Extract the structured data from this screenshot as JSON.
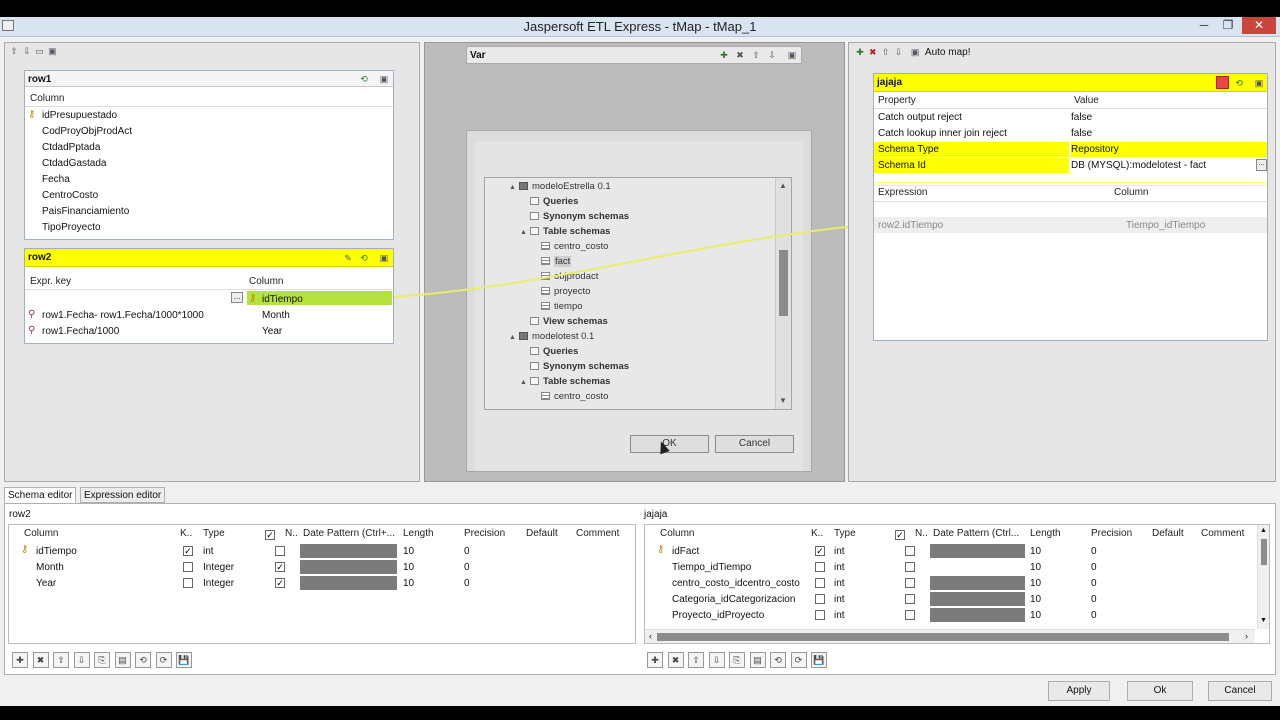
{
  "window": {
    "title": "Jaspersoft ETL Express - tMap - tMap_1",
    "minimize": "─",
    "maximize": "❐",
    "close": "✕"
  },
  "input": {
    "row1": {
      "title": "row1",
      "column_header": "Column",
      "columns": [
        "idPresupuestado",
        "CodProyObjProdAct",
        "CtdadPptada",
        "CtdadGastada",
        "Fecha",
        "CentroCosto",
        "PaisFinanciamiento",
        "TipoProyecto"
      ]
    },
    "row2": {
      "title": "row2",
      "expr_header": "Expr. key",
      "column_header": "Column",
      "ellipsis": "...",
      "rows": [
        {
          "expr": "",
          "column": "idTiempo"
        },
        {
          "expr": "row1.Fecha- row1.Fecha/1000*1000",
          "column": "Month"
        },
        {
          "expr": "row1.Fecha/1000",
          "column": "Year"
        }
      ]
    }
  },
  "var": {
    "title": "Var"
  },
  "dialog": {
    "tree": [
      {
        "label": "modeloEstrella 0.1",
        "level": 0,
        "kind": "db",
        "arrow": "▲"
      },
      {
        "label": "Queries",
        "level": 1,
        "kind": "folder",
        "bold": true
      },
      {
        "label": "Synonym schemas",
        "level": 1,
        "kind": "folder",
        "bold": true
      },
      {
        "label": "Table schemas",
        "level": 1,
        "kind": "folder",
        "bold": true,
        "arrow": "▲"
      },
      {
        "label": "centro_costo",
        "level": 2,
        "kind": "tbl"
      },
      {
        "label": "fact",
        "level": 2,
        "kind": "tbl",
        "selected": true
      },
      {
        "label": "objprodact",
        "level": 2,
        "kind": "tbl"
      },
      {
        "label": "proyecto",
        "level": 2,
        "kind": "tbl"
      },
      {
        "label": "tiempo",
        "level": 2,
        "kind": "tbl"
      },
      {
        "label": "View schemas",
        "level": 1,
        "kind": "folder",
        "bold": true
      },
      {
        "label": "modelotest 0.1",
        "level": 0,
        "kind": "db",
        "arrow": "▲"
      },
      {
        "label": "Queries",
        "level": 1,
        "kind": "folder",
        "bold": true
      },
      {
        "label": "Synonym schemas",
        "level": 1,
        "kind": "folder",
        "bold": true
      },
      {
        "label": "Table schemas",
        "level": 1,
        "kind": "folder",
        "bold": true,
        "arrow": "▲"
      },
      {
        "label": "centro_costo",
        "level": 2,
        "kind": "tbl"
      }
    ],
    "ok": "OK",
    "cancel": "Cancel"
  },
  "output": {
    "toolbar_label": "Auto map!",
    "title": "jajaja",
    "property_header": "Property",
    "value_header": "Value",
    "properties": [
      {
        "name": "Catch output reject",
        "value": "false"
      },
      {
        "name": "Catch lookup inner join reject",
        "value": "false"
      },
      {
        "name": "Schema Type",
        "value": "Repository"
      },
      {
        "name": "Schema Id",
        "value": "DB (MYSQL):modelotest - fact"
      }
    ],
    "expression_header": "Expression",
    "column_header": "Column",
    "mapping": {
      "expr": "row2.idTiempo",
      "column": "Tiempo_idTiempo"
    }
  },
  "bottom": {
    "tabs": [
      "Schema editor",
      "Expression editor"
    ],
    "left": {
      "title": "row2",
      "headers": [
        "Column",
        "K..",
        "Type",
        "N..",
        "Date Pattern (Ctrl+...",
        "Length",
        "Precision",
        "Default",
        "Comment"
      ],
      "rows": [
        {
          "column": "idTiempo",
          "key": true,
          "type": "int",
          "nullable": false,
          "length": "10",
          "precision": "0"
        },
        {
          "column": "Month",
          "key": false,
          "type": "Integer",
          "nullable": true,
          "length": "10",
          "precision": "0"
        },
        {
          "column": "Year",
          "key": false,
          "type": "Integer",
          "nullable": true,
          "length": "10",
          "precision": "0"
        }
      ]
    },
    "right": {
      "title": "jajaja",
      "headers": [
        "Column",
        "K..",
        "Type",
        "N..",
        "Date Pattern (Ctrl...",
        "Length",
        "Precision",
        "Default",
        "Comment"
      ],
      "rows": [
        {
          "column": "idFact",
          "key": true,
          "type": "int",
          "nullable": false,
          "length": "10",
          "precision": "0"
        },
        {
          "column": "Tiempo_idTiempo",
          "key": false,
          "type": "int",
          "nullable": false,
          "length": "10",
          "precision": "0"
        },
        {
          "column": "centro_costo_idcentro_costo",
          "key": false,
          "type": "int",
          "nullable": false,
          "length": "10",
          "precision": "0"
        },
        {
          "column": "Categoria_idCategorizacion",
          "key": false,
          "type": "int",
          "nullable": false,
          "length": "10",
          "precision": "0"
        },
        {
          "column": "Proyecto_idProyecto",
          "key": false,
          "type": "int",
          "nullable": false,
          "length": "10",
          "precision": "0"
        }
      ]
    },
    "buttons": {
      "apply": "Apply",
      "ok": "Ok",
      "cancel": "Cancel"
    }
  },
  "colors": {
    "highlight": "#ffff00",
    "link": "#e8e86a",
    "close": "#c7473d"
  },
  "icons": [
    "key-icon",
    "magnifier-icon",
    "add-icon",
    "remove-icon",
    "arrow-up-icon",
    "arrow-down-icon",
    "checkbox-icon",
    "chevron-left-icon",
    "chevron-right-icon"
  ]
}
